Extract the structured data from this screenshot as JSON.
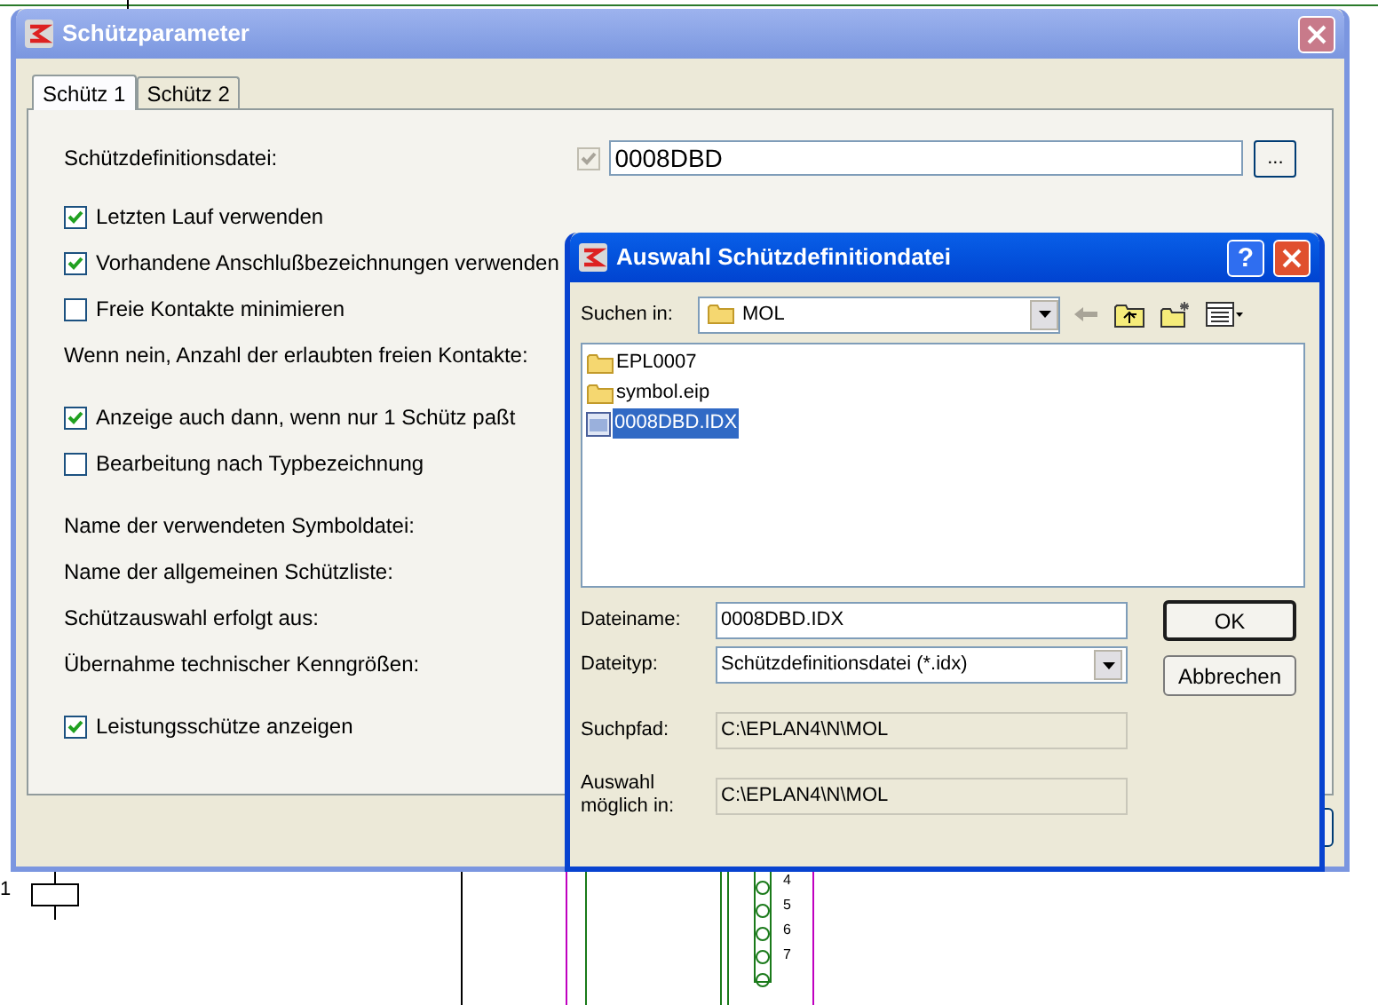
{
  "schematic": {
    "device_label": "1",
    "terminal_numbers": [
      "4",
      "5",
      "6",
      "7"
    ]
  },
  "main_window": {
    "title": "Schützparameter",
    "active": false,
    "tabs": [
      {
        "label": "Schütz 1",
        "selected": true
      },
      {
        "label": "Schütz 2",
        "selected": false
      }
    ],
    "definition_file": {
      "label": "Schützdefinitionsdatei:",
      "checked": true,
      "value": "0008DBD",
      "browse_button": "..."
    },
    "option_groups": [
      [
        {
          "kind": "checkbox",
          "label": "Letzten Lauf verwenden",
          "checked": true
        },
        {
          "kind": "checkbox",
          "label": "Vorhandene Anschlußbezeichnungen verwenden",
          "checked": true
        },
        {
          "kind": "checkbox",
          "label": "Freie Kontakte minimieren",
          "checked": false
        },
        {
          "kind": "label",
          "label": "Wenn nein, Anzahl der erlaubten freien Kontakte:"
        }
      ],
      [
        {
          "kind": "checkbox",
          "label": "Anzeige auch dann, wenn nur 1 Schütz paßt",
          "checked": true
        },
        {
          "kind": "checkbox",
          "label": "Bearbeitung nach Typbezeichnung",
          "checked": false
        }
      ],
      [
        {
          "kind": "label",
          "label": "Name der verwendeten Symboldatei:"
        },
        {
          "kind": "label",
          "label": "Name der allgemeinen Schützliste:"
        },
        {
          "kind": "label",
          "label": "Schützauswahl erfolgt aus:"
        },
        {
          "kind": "label",
          "label": "Übernahme technischer Kenngrößen:"
        }
      ],
      [
        {
          "kind": "checkbox",
          "label": "Leistungsschütze anzeigen",
          "checked": true
        }
      ]
    ]
  },
  "file_dialog": {
    "title": "Auswahl Schützdefinitiondatei",
    "active": true,
    "help_button": "?",
    "look_in": {
      "label": "Suchen in:",
      "value": "MOL"
    },
    "files": [
      {
        "kind": "folder",
        "name": "EPL0007",
        "selected": false
      },
      {
        "kind": "folder",
        "name": "symbol.eip",
        "selected": false
      },
      {
        "kind": "file",
        "name": "0008DBD.IDX",
        "selected": true
      }
    ],
    "file_name": {
      "label": "Dateiname:",
      "value": "0008DBD.IDX"
    },
    "file_type": {
      "label": "Dateityp:",
      "value": "Schützdefinitionsdatei (*.idx)"
    },
    "search_path": {
      "label": "Suchpfad:",
      "value": "C:\\EPLAN4\\N\\MOL"
    },
    "selection_path": {
      "label": "Auswahl möglich in:",
      "value": "C:\\EPLAN4\\N\\MOL"
    },
    "buttons": [
      {
        "label": "OK",
        "default": true
      },
      {
        "label": "Abbrechen",
        "default": false
      }
    ]
  }
}
